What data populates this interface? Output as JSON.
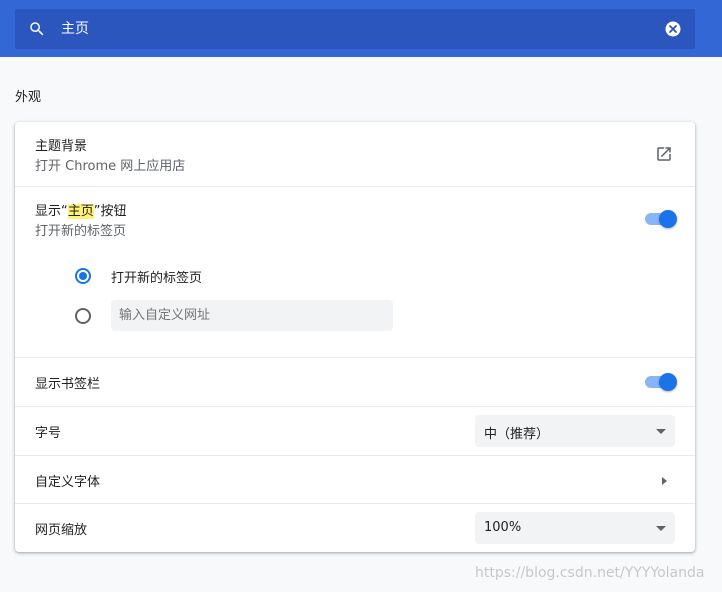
{
  "search": {
    "query": "主页"
  },
  "section": {
    "title": "外观"
  },
  "theme": {
    "title": "主题背景",
    "subtitle": "打开 Chrome 网上应用店"
  },
  "home_button": {
    "title_prefix": "显示“",
    "title_highlight": "主页",
    "title_suffix": "”按钮",
    "subtitle": "打开新的标签页",
    "enabled": true,
    "options": [
      {
        "label": "打开新的标签页",
        "selected": true
      },
      {
        "placeholder": "输入自定义网址",
        "selected": false
      }
    ]
  },
  "bookmarks_bar": {
    "label": "显示书签栏",
    "enabled": true
  },
  "font_size": {
    "label": "字号",
    "value": "中（推荐）"
  },
  "custom_fonts": {
    "label": "自定义字体"
  },
  "page_zoom": {
    "label": "网页缩放",
    "value": "100%"
  },
  "colors": {
    "header": "#3367d6",
    "accent": "#1a73e8",
    "highlight": "#fff173"
  },
  "watermark": "https://blog.csdn.net/YYYYolanda"
}
